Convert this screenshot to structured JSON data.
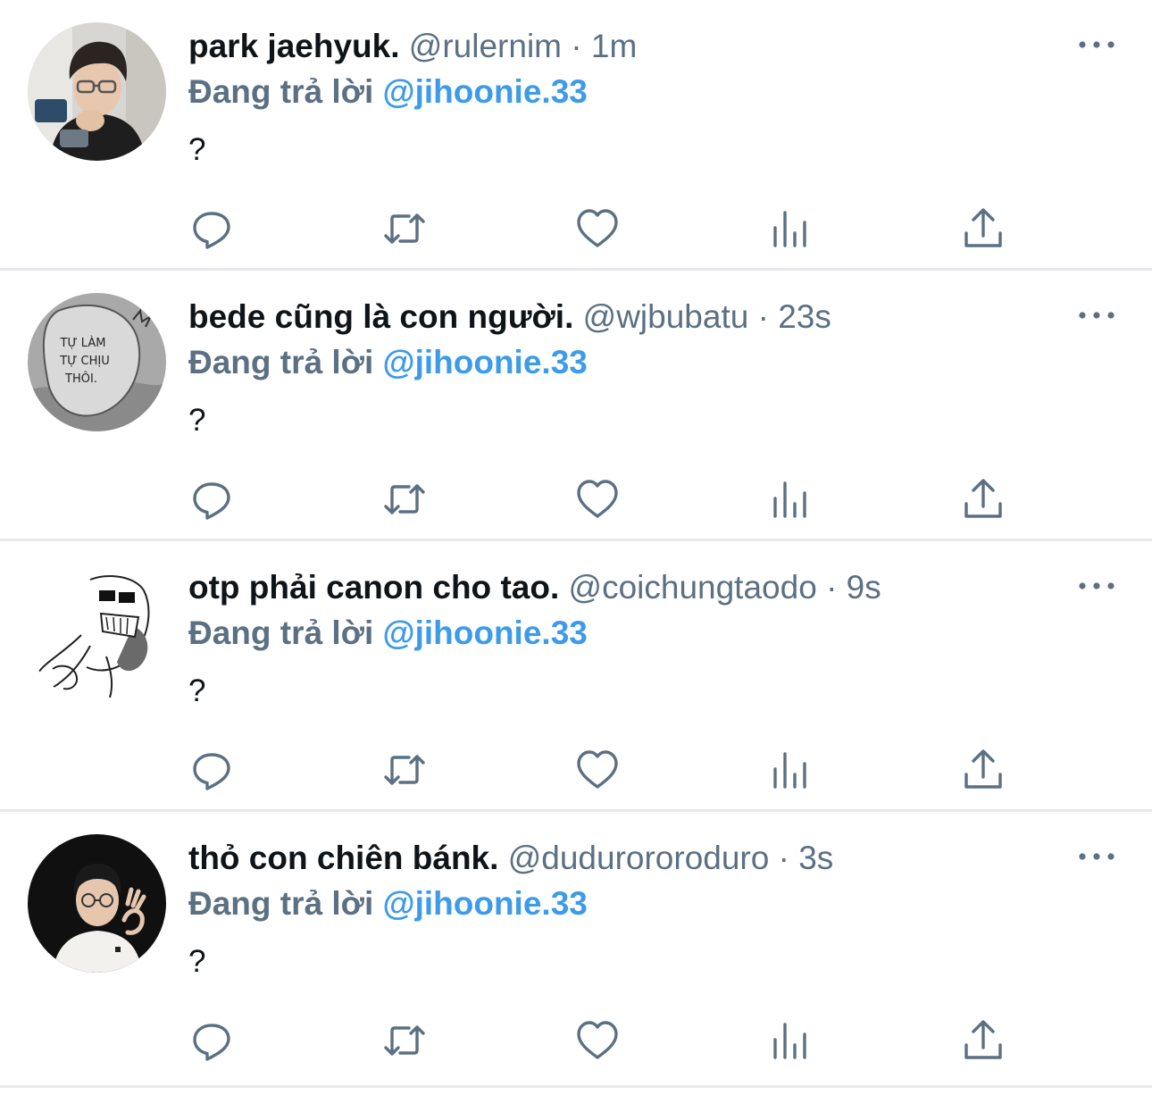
{
  "colors": {
    "name": "#0f1419",
    "meta": "#5b7083",
    "mention": "#3d9be9",
    "divider": "#e7e9ec"
  },
  "tweets": [
    {
      "name": "park jaehyuk.",
      "handle": "@rulernim",
      "separator": "·",
      "time": "1m",
      "reply_prefix": "Đang trả lời",
      "reply_to": "@jihoonie.33",
      "text": "?"
    },
    {
      "name": "bede cũng là con người.",
      "handle": "@wjbubatu",
      "separator": "·",
      "time": "23s",
      "reply_prefix": "Đang trả lời",
      "reply_to": "@jihoonie.33",
      "text": "?"
    },
    {
      "name": "otp phải canon cho tao.",
      "handle": "@coichungtaodo",
      "separator": "·",
      "time": "9s",
      "reply_prefix": "Đang trả lời",
      "reply_to": "@jihoonie.33",
      "text": "?"
    },
    {
      "name": "thỏ con chiên bánk.",
      "handle": "@dudurororoduro",
      "separator": "·",
      "time": "3s",
      "reply_prefix": "Đang trả lời",
      "reply_to": "@jihoonie.33",
      "text": "?"
    }
  ],
  "avatar_texts": {
    "tweet2": [
      "TỰ LÀM",
      "TỰ CHỊU",
      "THÔI."
    ]
  },
  "icons": [
    "reply-icon",
    "retweet-icon",
    "like-icon",
    "analytics-icon",
    "share-icon",
    "more-icon"
  ]
}
